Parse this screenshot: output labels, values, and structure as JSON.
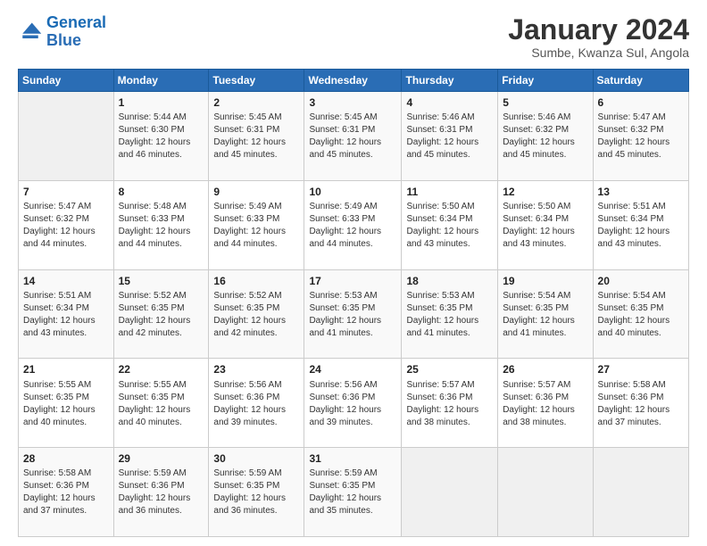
{
  "logo": {
    "line1": "General",
    "line2": "Blue"
  },
  "title": "January 2024",
  "subtitle": "Sumbe, Kwanza Sul, Angola",
  "days_header": [
    "Sunday",
    "Monday",
    "Tuesday",
    "Wednesday",
    "Thursday",
    "Friday",
    "Saturday"
  ],
  "weeks": [
    [
      {
        "day": "",
        "info": ""
      },
      {
        "day": "1",
        "info": "Sunrise: 5:44 AM\nSunset: 6:30 PM\nDaylight: 12 hours\nand 46 minutes."
      },
      {
        "day": "2",
        "info": "Sunrise: 5:45 AM\nSunset: 6:31 PM\nDaylight: 12 hours\nand 45 minutes."
      },
      {
        "day": "3",
        "info": "Sunrise: 5:45 AM\nSunset: 6:31 PM\nDaylight: 12 hours\nand 45 minutes."
      },
      {
        "day": "4",
        "info": "Sunrise: 5:46 AM\nSunset: 6:31 PM\nDaylight: 12 hours\nand 45 minutes."
      },
      {
        "day": "5",
        "info": "Sunrise: 5:46 AM\nSunset: 6:32 PM\nDaylight: 12 hours\nand 45 minutes."
      },
      {
        "day": "6",
        "info": "Sunrise: 5:47 AM\nSunset: 6:32 PM\nDaylight: 12 hours\nand 45 minutes."
      }
    ],
    [
      {
        "day": "7",
        "info": "Sunrise: 5:47 AM\nSunset: 6:32 PM\nDaylight: 12 hours\nand 44 minutes."
      },
      {
        "day": "8",
        "info": "Sunrise: 5:48 AM\nSunset: 6:33 PM\nDaylight: 12 hours\nand 44 minutes."
      },
      {
        "day": "9",
        "info": "Sunrise: 5:49 AM\nSunset: 6:33 PM\nDaylight: 12 hours\nand 44 minutes."
      },
      {
        "day": "10",
        "info": "Sunrise: 5:49 AM\nSunset: 6:33 PM\nDaylight: 12 hours\nand 44 minutes."
      },
      {
        "day": "11",
        "info": "Sunrise: 5:50 AM\nSunset: 6:34 PM\nDaylight: 12 hours\nand 43 minutes."
      },
      {
        "day": "12",
        "info": "Sunrise: 5:50 AM\nSunset: 6:34 PM\nDaylight: 12 hours\nand 43 minutes."
      },
      {
        "day": "13",
        "info": "Sunrise: 5:51 AM\nSunset: 6:34 PM\nDaylight: 12 hours\nand 43 minutes."
      }
    ],
    [
      {
        "day": "14",
        "info": "Sunrise: 5:51 AM\nSunset: 6:34 PM\nDaylight: 12 hours\nand 43 minutes."
      },
      {
        "day": "15",
        "info": "Sunrise: 5:52 AM\nSunset: 6:35 PM\nDaylight: 12 hours\nand 42 minutes."
      },
      {
        "day": "16",
        "info": "Sunrise: 5:52 AM\nSunset: 6:35 PM\nDaylight: 12 hours\nand 42 minutes."
      },
      {
        "day": "17",
        "info": "Sunrise: 5:53 AM\nSunset: 6:35 PM\nDaylight: 12 hours\nand 41 minutes."
      },
      {
        "day": "18",
        "info": "Sunrise: 5:53 AM\nSunset: 6:35 PM\nDaylight: 12 hours\nand 41 minutes."
      },
      {
        "day": "19",
        "info": "Sunrise: 5:54 AM\nSunset: 6:35 PM\nDaylight: 12 hours\nand 41 minutes."
      },
      {
        "day": "20",
        "info": "Sunrise: 5:54 AM\nSunset: 6:35 PM\nDaylight: 12 hours\nand 40 minutes."
      }
    ],
    [
      {
        "day": "21",
        "info": "Sunrise: 5:55 AM\nSunset: 6:35 PM\nDaylight: 12 hours\nand 40 minutes."
      },
      {
        "day": "22",
        "info": "Sunrise: 5:55 AM\nSunset: 6:35 PM\nDaylight: 12 hours\nand 40 minutes."
      },
      {
        "day": "23",
        "info": "Sunrise: 5:56 AM\nSunset: 6:36 PM\nDaylight: 12 hours\nand 39 minutes."
      },
      {
        "day": "24",
        "info": "Sunrise: 5:56 AM\nSunset: 6:36 PM\nDaylight: 12 hours\nand 39 minutes."
      },
      {
        "day": "25",
        "info": "Sunrise: 5:57 AM\nSunset: 6:36 PM\nDaylight: 12 hours\nand 38 minutes."
      },
      {
        "day": "26",
        "info": "Sunrise: 5:57 AM\nSunset: 6:36 PM\nDaylight: 12 hours\nand 38 minutes."
      },
      {
        "day": "27",
        "info": "Sunrise: 5:58 AM\nSunset: 6:36 PM\nDaylight: 12 hours\nand 37 minutes."
      }
    ],
    [
      {
        "day": "28",
        "info": "Sunrise: 5:58 AM\nSunset: 6:36 PM\nDaylight: 12 hours\nand 37 minutes."
      },
      {
        "day": "29",
        "info": "Sunrise: 5:59 AM\nSunset: 6:36 PM\nDaylight: 12 hours\nand 36 minutes."
      },
      {
        "day": "30",
        "info": "Sunrise: 5:59 AM\nSunset: 6:35 PM\nDaylight: 12 hours\nand 36 minutes."
      },
      {
        "day": "31",
        "info": "Sunrise: 5:59 AM\nSunset: 6:35 PM\nDaylight: 12 hours\nand 35 minutes."
      },
      {
        "day": "",
        "info": ""
      },
      {
        "day": "",
        "info": ""
      },
      {
        "day": "",
        "info": ""
      }
    ]
  ]
}
